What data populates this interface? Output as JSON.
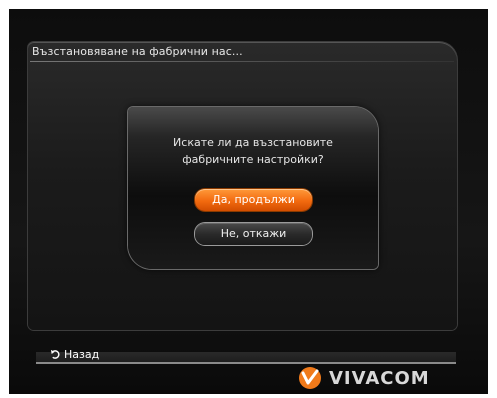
{
  "panel": {
    "title": "Възстановяване на фабрични нас..."
  },
  "dialog": {
    "message_line1": "Искате ли да възстановите",
    "message_line2": "фабричните настройки?",
    "confirm_label": "Да, продължи",
    "cancel_label": "Не, откажи"
  },
  "footer": {
    "back_label": "Назад",
    "brand": "VIVACOM"
  },
  "colors": {
    "accent": "#f26a0f",
    "background": "#141414",
    "text": "#e6e6e6"
  },
  "icons": {
    "back": "back-arrow-icon",
    "logo": "vivacom-logo-icon"
  }
}
